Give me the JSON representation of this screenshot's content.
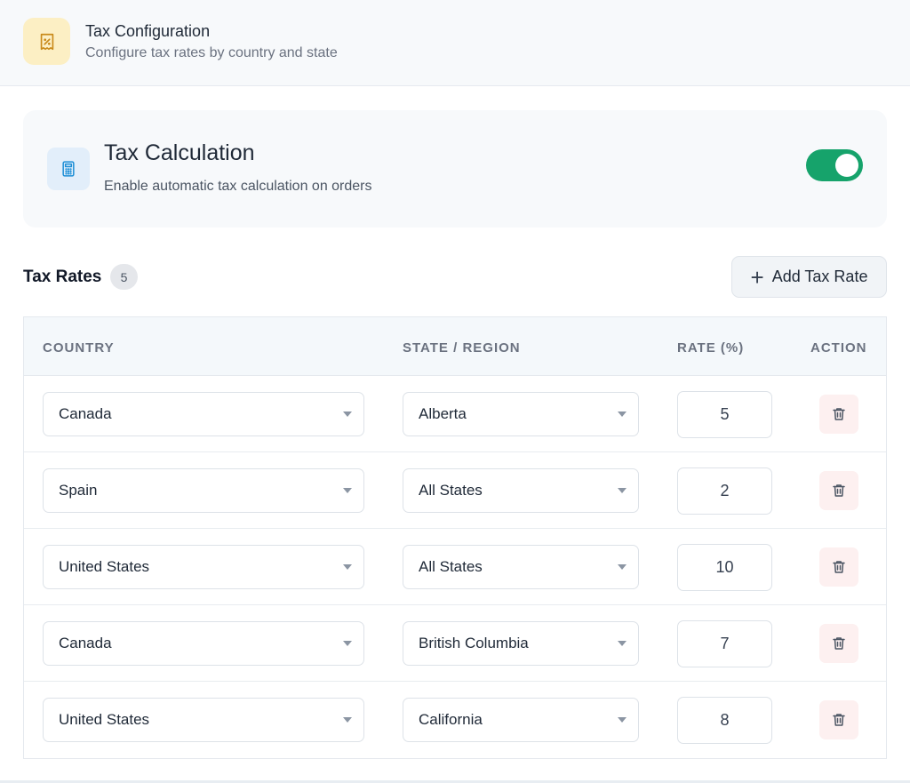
{
  "header": {
    "title": "Tax Configuration",
    "subtitle": "Configure tax rates by country and state",
    "icon": "receipt-percent-icon"
  },
  "tax_calculation": {
    "title": "Tax Calculation",
    "description": "Enable automatic tax calculation on orders",
    "enabled": true,
    "icon": "calculator-icon"
  },
  "rates": {
    "title": "Tax Rates",
    "count": "5",
    "add_label": "Add Tax Rate",
    "columns": {
      "country": "COUNTRY",
      "state": "STATE / REGION",
      "rate": "RATE (%)",
      "action": "ACTION"
    },
    "rows": [
      {
        "country": "Canada",
        "state": "Alberta",
        "rate": "5"
      },
      {
        "country": "Spain",
        "state": "All States",
        "rate": "2"
      },
      {
        "country": "United States",
        "state": "All States",
        "rate": "10"
      },
      {
        "country": "Canada",
        "state": "British Columbia",
        "rate": "7"
      },
      {
        "country": "United States",
        "state": "California",
        "rate": "8"
      }
    ]
  },
  "colors": {
    "toggle_on": "#16a36b",
    "delete_bg": "#fdf0f0",
    "delete_icon": "#4b5563"
  }
}
